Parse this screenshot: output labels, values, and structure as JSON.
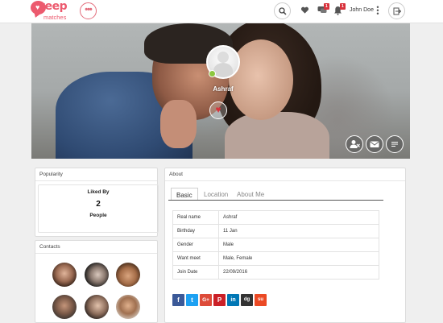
{
  "header": {
    "logo": {
      "word": "yeep",
      "sub": "matches"
    },
    "more_icon_text": "•••",
    "notifications": {
      "messages_count": "1",
      "alerts_count": "1"
    },
    "user_name": "John Doe",
    "user_menu_glyph": "⋮",
    "icons": [
      "search-icon",
      "heart-icon",
      "chat-icon",
      "bell-icon",
      "logout-icon"
    ],
    "brand_color": "#ec5a6e"
  },
  "profile": {
    "name": "Ashraf",
    "online": true,
    "like_glyph": "♥"
  },
  "popularity": {
    "title": "Popularity",
    "liked_by_label": "Liked By",
    "count": "2",
    "unit": "People"
  },
  "contacts": {
    "title": "Contacts",
    "count": 6
  },
  "about": {
    "title": "About",
    "tabs": [
      {
        "label": "Basic",
        "active": true
      },
      {
        "label": "Location",
        "active": false
      },
      {
        "label": "About Me",
        "active": false
      }
    ],
    "rows": [
      {
        "key": "Real name",
        "value": "Ashraf"
      },
      {
        "key": "Birthday",
        "value": "11 Jan"
      },
      {
        "key": "Gender",
        "value": "Male"
      },
      {
        "key": "Want meet",
        "value": "Male, Female"
      },
      {
        "key": "Join Date",
        "value": "22/09/2016"
      }
    ],
    "share": [
      {
        "name": "facebook",
        "glyph": "f",
        "color": "#3b5998"
      },
      {
        "name": "twitter",
        "glyph": "t",
        "color": "#1da1f2"
      },
      {
        "name": "google-plus",
        "glyph": "G+",
        "color": "#dd4b39"
      },
      {
        "name": "pinterest",
        "glyph": "P",
        "color": "#cb2027"
      },
      {
        "name": "linkedin",
        "glyph": "in",
        "color": "#0077b5"
      },
      {
        "name": "digg",
        "glyph": "dg",
        "color": "#333333"
      },
      {
        "name": "stumbleupon",
        "glyph": "su",
        "color": "#eb4924"
      }
    ]
  }
}
